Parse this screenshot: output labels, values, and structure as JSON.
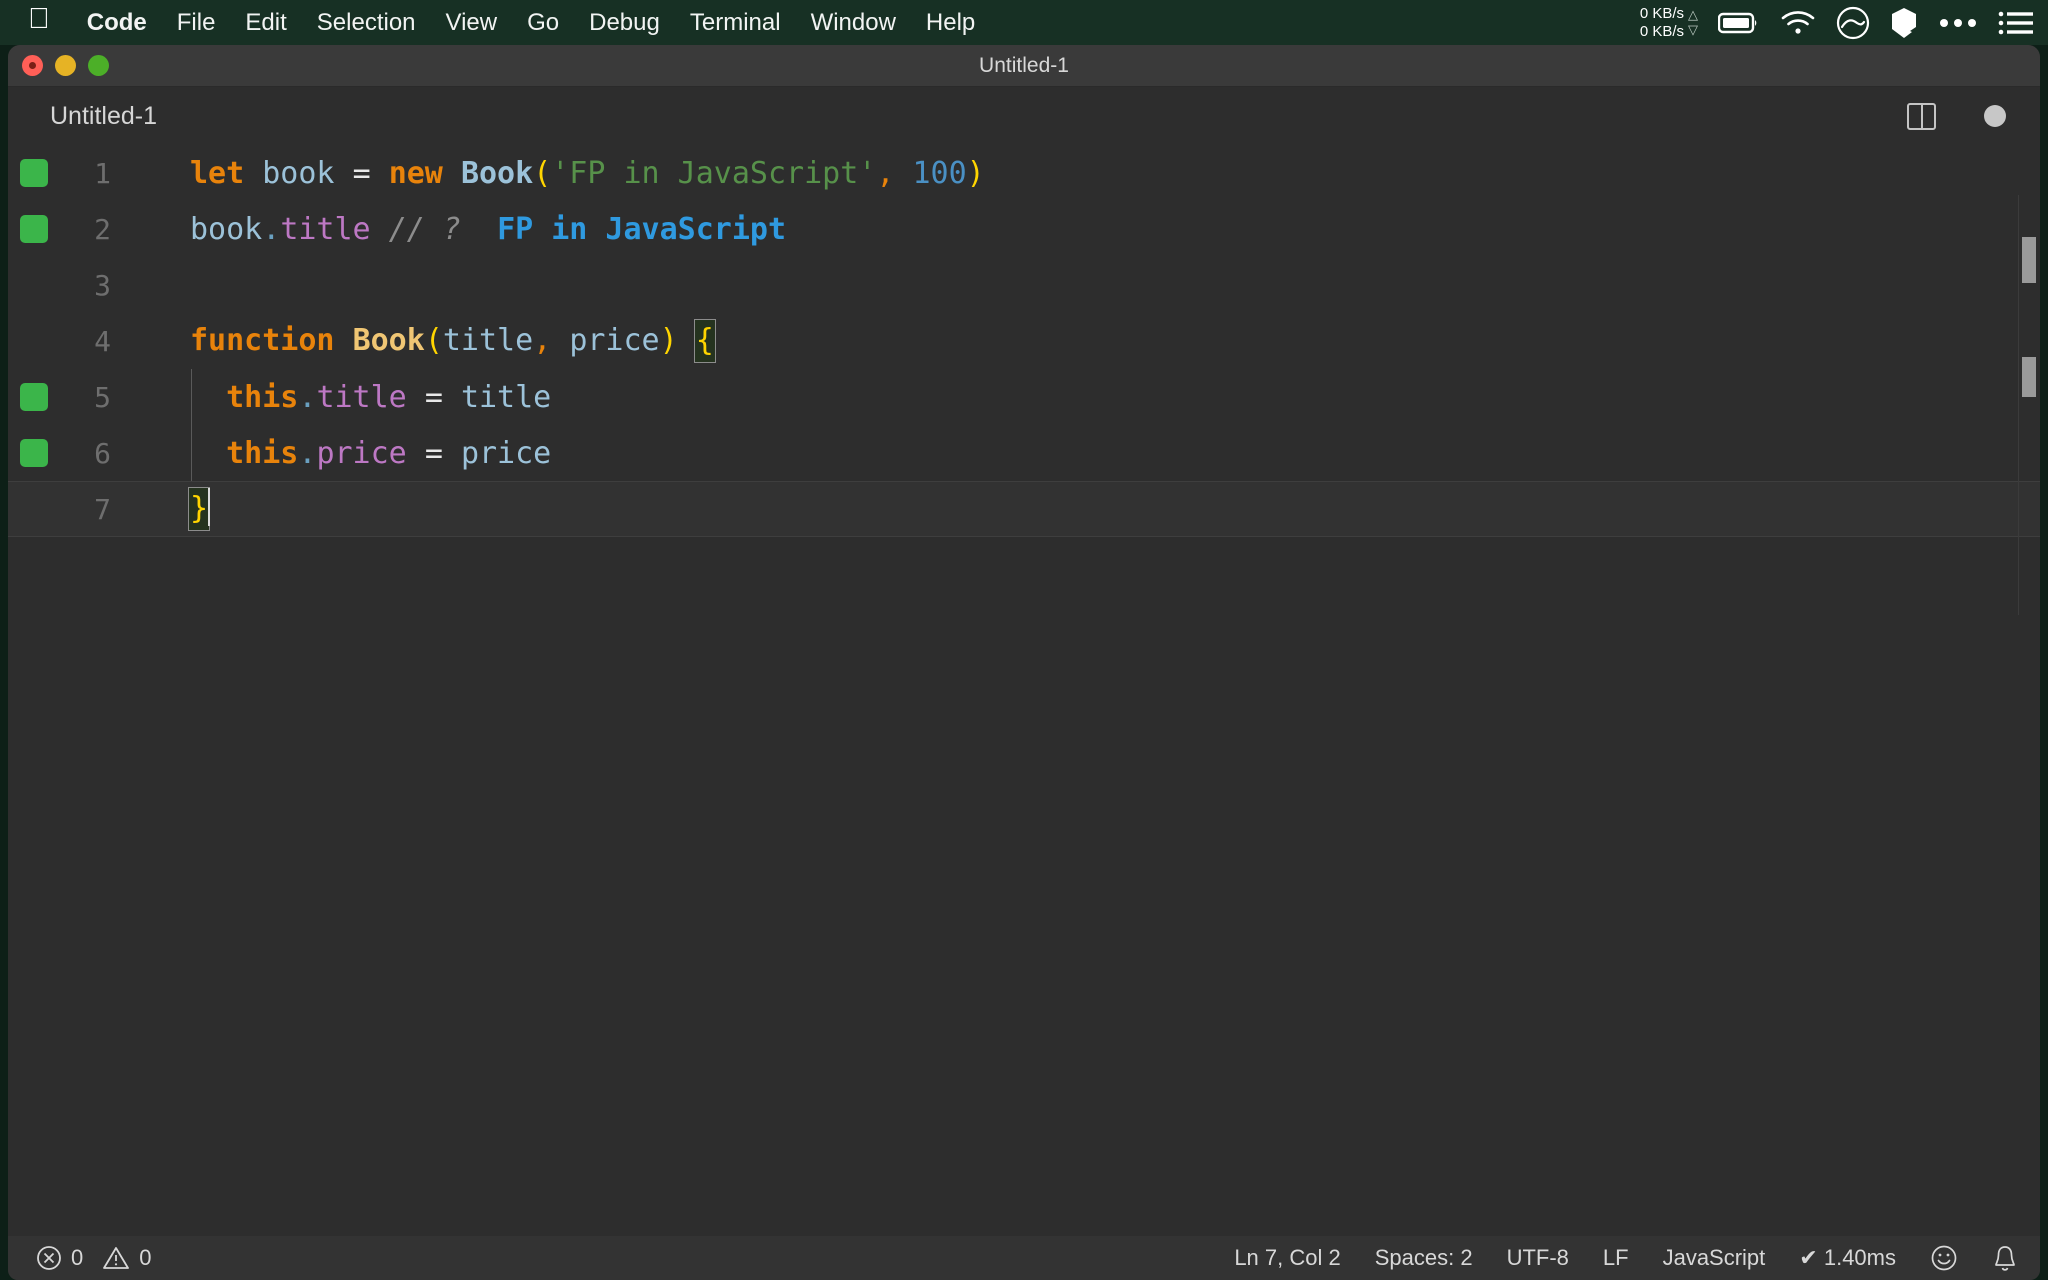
{
  "menubar": {
    "apple_icon": "apple-logo-icon",
    "items": [
      {
        "label": "Code",
        "bold": true
      },
      {
        "label": "File",
        "bold": false
      },
      {
        "label": "Edit",
        "bold": false
      },
      {
        "label": "Selection",
        "bold": false
      },
      {
        "label": "View",
        "bold": false
      },
      {
        "label": "Go",
        "bold": false
      },
      {
        "label": "Debug",
        "bold": false
      },
      {
        "label": "Terminal",
        "bold": false
      },
      {
        "label": "Window",
        "bold": false
      },
      {
        "label": "Help",
        "bold": false
      }
    ],
    "network": {
      "upload": "0 KB/s",
      "download": "0 KB/s",
      "up_arrow": "triangle-up-icon",
      "down_arrow": "triangle-down-icon"
    },
    "status_icons": [
      "battery-icon",
      "wifi-icon",
      "circle-curve-icon",
      "cube-icon",
      "three-dots-icon",
      "list-menu-icon"
    ],
    "background_color": "#173024"
  },
  "window": {
    "title": "Untitled-1",
    "traffic_lights": [
      "close-button",
      "minimize-button",
      "maximize-button"
    ],
    "colors": {
      "close": "#ff5f57",
      "minimize": "#e6b325",
      "maximize": "#4caf28"
    }
  },
  "tab": {
    "label": "Untitled-1",
    "split_editor_icon": "split-editor-icon",
    "dirty_indicator": "unsaved-dot-icon"
  },
  "editor": {
    "language": "JavaScript",
    "lines": [
      {
        "number": "1",
        "has_run_marker": true,
        "current": false,
        "indent_guide": false,
        "tokens": [
          {
            "text": "let",
            "cls": "t-kw"
          },
          {
            "text": " ",
            "cls": "t-op"
          },
          {
            "text": "book",
            "cls": "t-var"
          },
          {
            "text": " ",
            "cls": "t-op"
          },
          {
            "text": "=",
            "cls": "t-op"
          },
          {
            "text": " ",
            "cls": "t-op"
          },
          {
            "text": "new",
            "cls": "t-kw"
          },
          {
            "text": " ",
            "cls": "t-op"
          },
          {
            "text": "Book",
            "cls": "t-fn"
          },
          {
            "text": "(",
            "cls": "t-brkt"
          },
          {
            "text": "'FP in JavaScript'",
            "cls": "t-str"
          },
          {
            "text": ",",
            "cls": "t-punc"
          },
          {
            "text": " ",
            "cls": "t-op"
          },
          {
            "text": "100",
            "cls": "t-num"
          },
          {
            "text": ")",
            "cls": "t-brkt"
          }
        ]
      },
      {
        "number": "2",
        "has_run_marker": true,
        "current": false,
        "indent_guide": false,
        "tokens": [
          {
            "text": "book",
            "cls": "t-var"
          },
          {
            "text": ".",
            "cls": "t-dot"
          },
          {
            "text": "title",
            "cls": "t-prop"
          },
          {
            "text": " ",
            "cls": "t-op"
          },
          {
            "text": "// ?",
            "cls": "t-comment"
          },
          {
            "text": "  ",
            "cls": "t-op"
          },
          {
            "text": "FP in JavaScript",
            "cls": "t-quokka"
          }
        ]
      },
      {
        "number": "3",
        "has_run_marker": false,
        "current": false,
        "indent_guide": false,
        "tokens": []
      },
      {
        "number": "4",
        "has_run_marker": false,
        "current": false,
        "indent_guide": false,
        "tokens": [
          {
            "text": "function",
            "cls": "t-kw"
          },
          {
            "text": " ",
            "cls": "t-op"
          },
          {
            "text": "Book",
            "cls": "t-fndef"
          },
          {
            "text": "(",
            "cls": "t-brkt"
          },
          {
            "text": "title",
            "cls": "t-param"
          },
          {
            "text": ",",
            "cls": "t-punc"
          },
          {
            "text": " ",
            "cls": "t-op"
          },
          {
            "text": "price",
            "cls": "t-param"
          },
          {
            "text": ")",
            "cls": "t-brkt"
          },
          {
            "text": " ",
            "cls": "t-op"
          },
          {
            "text": "{",
            "cls": "t-brkt brkt-match"
          }
        ]
      },
      {
        "number": "5",
        "has_run_marker": true,
        "current": false,
        "indent_guide": true,
        "tokens": [
          {
            "text": "  ",
            "cls": "t-op"
          },
          {
            "text": "this",
            "cls": "t-kw"
          },
          {
            "text": ".",
            "cls": "t-dot"
          },
          {
            "text": "title",
            "cls": "t-prop"
          },
          {
            "text": " ",
            "cls": "t-op"
          },
          {
            "text": "=",
            "cls": "t-op"
          },
          {
            "text": " ",
            "cls": "t-op"
          },
          {
            "text": "title",
            "cls": "t-param"
          }
        ]
      },
      {
        "number": "6",
        "has_run_marker": true,
        "current": false,
        "indent_guide": true,
        "tokens": [
          {
            "text": "  ",
            "cls": "t-op"
          },
          {
            "text": "this",
            "cls": "t-kw"
          },
          {
            "text": ".",
            "cls": "t-dot"
          },
          {
            "text": "price",
            "cls": "t-prop"
          },
          {
            "text": " ",
            "cls": "t-op"
          },
          {
            "text": "=",
            "cls": "t-op"
          },
          {
            "text": " ",
            "cls": "t-op"
          },
          {
            "text": "price",
            "cls": "t-param"
          }
        ]
      },
      {
        "number": "7",
        "has_run_marker": false,
        "current": true,
        "indent_guide": false,
        "tokens": [
          {
            "text": "}",
            "cls": "t-brkt brkt-match"
          }
        ],
        "cursor_after": true
      }
    ]
  },
  "statusbar": {
    "errors": {
      "icon": "error-circle-icon",
      "count": "0"
    },
    "warnings": {
      "icon": "warning-triangle-icon",
      "count": "0"
    },
    "cursor_position": "Ln 7, Col 2",
    "indentation": "Spaces: 2",
    "encoding": "UTF-8",
    "eol": "LF",
    "language": "JavaScript",
    "quokka_time": "✔ 1.40ms",
    "feedback_icon": "smiley-icon",
    "notifications_icon": "bell-icon"
  }
}
